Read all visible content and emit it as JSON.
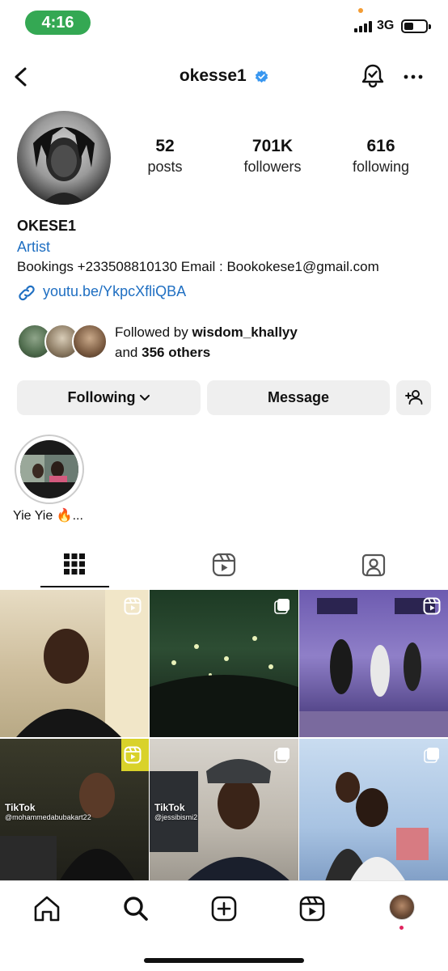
{
  "status_bar": {
    "time": "4:16",
    "network": "3G",
    "colors": {
      "time_pill": "#34a853"
    }
  },
  "header": {
    "username": "okesse1",
    "back_icon": "chevron-left-icon",
    "verified_icon": "verified-badge-icon",
    "notify_icon": "bell-check-icon",
    "more_icon": "more-horizontal-icon"
  },
  "profile": {
    "stats": [
      {
        "value": "52",
        "label": "posts"
      },
      {
        "value": "701K",
        "label": "followers"
      },
      {
        "value": "616",
        "label": "following"
      }
    ],
    "display_name": "OKESE1",
    "category": "Artist",
    "bio": "Bookings +233508810130 Email : Bookokese1@gmail.com",
    "link": "youtu.be/YkpcXfliQBA",
    "followed_by_prefix": "Followed by",
    "followed_by_user": "wisdom_khallyy",
    "followed_by_and": "and",
    "followed_by_others": "356 others"
  },
  "actions": {
    "following_label": "Following",
    "message_label": "Message",
    "add_user_icon": "person-add-icon"
  },
  "highlights": [
    {
      "label": "Yie Yie 🔥..."
    }
  ],
  "tabs": [
    {
      "name": "grid",
      "icon": "grid-icon",
      "selected": true
    },
    {
      "name": "reels",
      "icon": "reels-icon",
      "selected": false
    },
    {
      "name": "tagged",
      "icon": "tagged-icon",
      "selected": false
    }
  ],
  "posts": [
    {
      "type": "reel",
      "tiktok": false
    },
    {
      "type": "carousel",
      "tiktok": false
    },
    {
      "type": "reel",
      "tiktok": false
    },
    {
      "type": "reel",
      "tiktok": true,
      "tiktok_label": "TikTok",
      "tiktok_handle": "@mohammedabubakart22"
    },
    {
      "type": "carousel",
      "tiktok": true,
      "tiktok_label": "TikTok",
      "tiktok_handle": "@jessibismi2"
    },
    {
      "type": "carousel",
      "tiktok": false
    }
  ],
  "bottom_nav": [
    {
      "name": "home",
      "icon": "home-icon"
    },
    {
      "name": "search",
      "icon": "search-icon"
    },
    {
      "name": "create",
      "icon": "plus-square-icon"
    },
    {
      "name": "reels",
      "icon": "reels-icon"
    },
    {
      "name": "profile",
      "icon": "avatar"
    }
  ],
  "colors": {
    "link": "#1f6fc2",
    "verified": "#3897f0",
    "button_bg": "#efefef"
  }
}
